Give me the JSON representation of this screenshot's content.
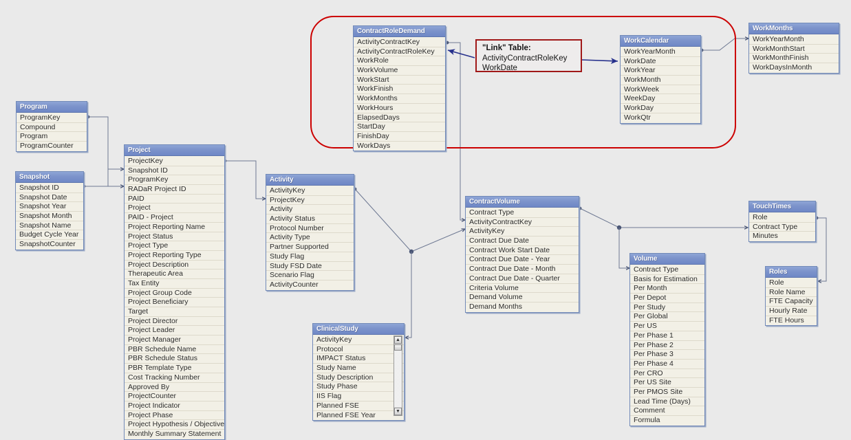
{
  "canvas": {
    "background": "#eaeaea",
    "header_color": "#7c93cb",
    "row_color": "#f2f0e6",
    "group_border_color": "#cc0000",
    "note_border_color": "#a01818",
    "connector_color": "#5a6580",
    "arrow_color": "#26308c"
  },
  "note": {
    "line1": "\"Link\" Table:",
    "line2": "ActivityContractRoleKey",
    "line3": "WorkDate"
  },
  "tables": {
    "program": {
      "title": "Program",
      "fields": [
        "ProgramKey",
        "Compound",
        "Program",
        "ProgramCounter"
      ]
    },
    "snapshot": {
      "title": "Snapshot",
      "fields": [
        "Snapshot ID",
        "Snapshot Date",
        "Snapshot Year",
        "Snapshot Month",
        "Snapshot Name",
        "Budget Cycle Year",
        "SnapshotCounter"
      ]
    },
    "project": {
      "title": "Project",
      "fields": [
        "ProjectKey",
        "Snapshot ID",
        "ProgramKey",
        "RADaR Project ID",
        "PAID",
        "Project",
        "PAID - Project",
        "Project Reporting Name",
        "Project Status",
        "Project Type",
        "Project Reporting Type",
        "Project Description",
        "Therapeutic Area",
        "Tax Entity",
        "Project Group Code",
        "Project Beneficiary",
        "Target",
        "Project Director",
        "Project Leader",
        "Project Manager",
        "PBR Schedule Name",
        "PBR Schedule Status",
        "PBR Template Type",
        "Cost Tracking Number",
        "Approved By",
        "ProjectCounter",
        "Project Indicator",
        "Project Phase",
        "Project Hypothesis / Objective",
        "Monthly Summary Statement"
      ]
    },
    "activity": {
      "title": "Activity",
      "fields": [
        "ActivityKey",
        "ProjectKey",
        "Activity",
        "Activity Status",
        "Protocol Number",
        "Activity Type",
        "Partner Supported",
        "Study Flag",
        "Study FSD Date",
        "Scenario Flag",
        "ActivityCounter"
      ]
    },
    "clinicalstudy": {
      "title": "ClinicalStudy",
      "fields": [
        "ActivityKey",
        "Protocol",
        "IMPACT Status",
        "Study Name",
        "Study Description",
        "Study Phase",
        "IIS Flag",
        "Planned FSE",
        "Planned FSE Year"
      ],
      "scroll_up": "▲",
      "scroll_down": "▼"
    },
    "contractroledemand": {
      "title": "ContractRoleDemand",
      "fields": [
        "ActivityContractKey",
        "ActivityContractRoleKey",
        "WorkRole",
        "WorkVolume",
        "WorkStart",
        "WorkFinish",
        "WorkMonths",
        "WorkHours",
        "ElapsedDays",
        "StartDay",
        "FinishDay",
        "WorkDays"
      ]
    },
    "workcalendar": {
      "title": "WorkCalendar",
      "fields": [
        "WorkYearMonth",
        "WorkDate",
        "WorkYear",
        "WorkMonth",
        "WorkWeek",
        "WeekDay",
        "WorkDay",
        "WorkQtr"
      ]
    },
    "workmonths": {
      "title": "WorkMonths",
      "fields": [
        "WorkYearMonth",
        "WorkMonthStart",
        "WorkMonthFinish",
        "WorkDaysInMonth"
      ]
    },
    "contractvolume": {
      "title": "ContractVolume",
      "fields": [
        "Contract Type",
        "ActivityContractKey",
        "ActivityKey",
        "Contract Due Date",
        "Contract Work Start Date",
        "Contract Due Date - Year",
        "Contract Due Date - Month",
        "Contract Due Date - Quarter",
        "Criteria Volume",
        "Demand Volume",
        "Demand Months"
      ]
    },
    "volume": {
      "title": "Volume",
      "fields": [
        "Contract Type",
        "Basis for Estimation",
        "Per Month",
        "Per Depot",
        "Per Study",
        "Per Global",
        "Per US",
        "Per Phase 1",
        "Per Phase 2",
        "Per Phase 3",
        "Per Phase 4",
        "Per CRO",
        "Per US Site",
        "Per PMOS Site",
        "Lead Time (Days)",
        "Comment",
        "Formula"
      ]
    },
    "touchtimes": {
      "title": "TouchTimes",
      "fields": [
        "Role",
        "Contract Type",
        "Minutes"
      ]
    },
    "roles": {
      "title": "Roles",
      "fields": [
        "Role",
        "Role Name",
        "FTE Capacity",
        "Hourly Rate",
        "FTE Hours"
      ]
    }
  }
}
